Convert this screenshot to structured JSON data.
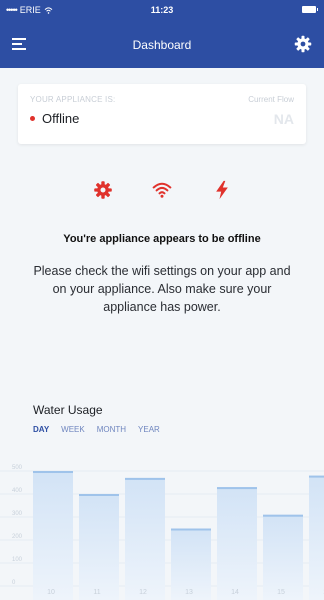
{
  "status_bar": {
    "carrier": "ERIE",
    "signal_dots": "•••••",
    "time": "11:23"
  },
  "nav": {
    "title": "Dashboard"
  },
  "appliance_card": {
    "label": "YOUR APPLIANCE IS:",
    "status": "Offline",
    "flow_label": "Current Flow",
    "flow_value": "NA"
  },
  "icons": [
    "gear-icon",
    "wifi-icon",
    "power-icon"
  ],
  "colors": {
    "brand": "#2d4ea3",
    "error": "#e0322c"
  },
  "message": {
    "title": "You're appliance appears to be offline",
    "body": "Please check the wifi settings on your app and on your appliance. Also make sure your appliance has power."
  },
  "usage": {
    "title": "Water Usage",
    "ranges": [
      "DAY",
      "WEEK",
      "MONTH",
      "YEAR"
    ],
    "selected_range": "DAY"
  },
  "chart_data": {
    "type": "bar",
    "categories": [
      "10",
      "11",
      "12",
      "13",
      "14",
      "15",
      "16"
    ],
    "values": [
      500,
      400,
      470,
      250,
      430,
      310,
      480
    ],
    "y_ticks": [
      "0",
      "100",
      "200",
      "300",
      "400",
      "500"
    ],
    "ylim": [
      0,
      600
    ],
    "grid": true
  }
}
